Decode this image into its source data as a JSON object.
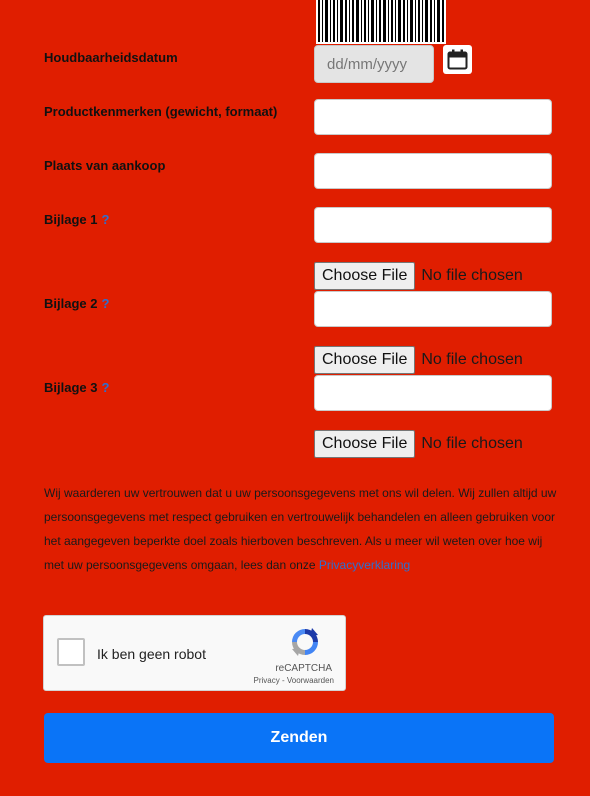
{
  "fields": {
    "expiry": {
      "label": "Houdbaarheidsdatum",
      "placeholder": "dd/mm/yyyy"
    },
    "product_features": {
      "label": "Productkenmerken (gewicht, formaat)",
      "value": ""
    },
    "purchase_place": {
      "label": "Plaats van aankoop",
      "value": ""
    },
    "attachment1": {
      "label": "Bijlage 1",
      "help": "?",
      "value": ""
    },
    "attachment2": {
      "label": "Bijlage 2",
      "help": "?",
      "value": ""
    },
    "attachment3": {
      "label": "Bijlage 3",
      "help": "?",
      "value": ""
    }
  },
  "file_upload": {
    "button_label": "Choose File",
    "status": "No file chosen"
  },
  "privacy": {
    "text": "Wij waarderen uw vertrouwen dat u uw persoonsgegevens met ons wil delen. Wij zullen altijd uw persoonsgegevens met respect gebruiken en vertrouwelijk behandelen en alleen gebruiken voor het aangegeven beperkte doel zoals hierboven beschreven. Als u meer wil weten over hoe wij met uw persoonsgegevens omgaan, lees dan onze ",
    "link_label": "Privacyverklaring"
  },
  "recaptcha": {
    "label": "Ik ben geen robot",
    "brand": "reCAPTCHA",
    "links": "Privacy - Voorwaarden"
  },
  "submit_label": "Zenden",
  "icons": {
    "calendar": "calendar-icon",
    "barcode": "barcode-icon",
    "recaptcha": "recaptcha-logo-icon"
  },
  "colors": {
    "background": "#e01e00",
    "submit_button": "#0a74f7",
    "help_link": "#2f6fcf"
  }
}
